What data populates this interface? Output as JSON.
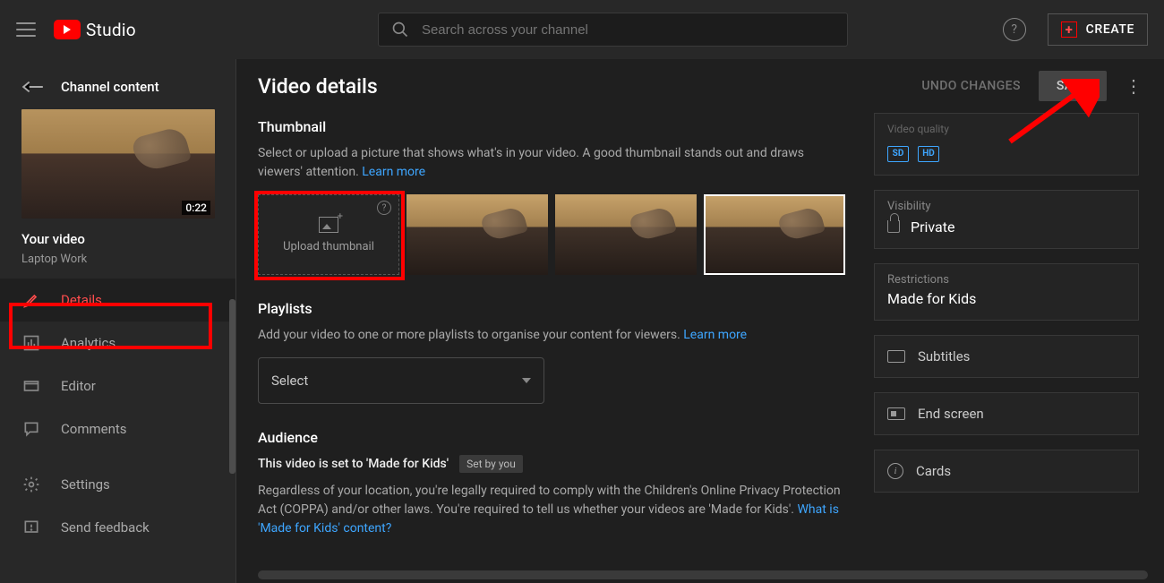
{
  "header": {
    "logo_text": "Studio",
    "search_placeholder": "Search across your channel",
    "create_label": "CREATE"
  },
  "sidebar": {
    "back_label": "Channel content",
    "video_duration": "0:22",
    "your_video_label": "Your video",
    "video_title": "Laptop Work",
    "items": [
      {
        "label": "Details"
      },
      {
        "label": "Analytics"
      },
      {
        "label": "Editor"
      },
      {
        "label": "Comments"
      },
      {
        "label": "Settings"
      },
      {
        "label": "Send feedback"
      }
    ]
  },
  "main": {
    "title": "Video details",
    "undo_label": "UNDO CHANGES",
    "save_label": "SAVE",
    "thumbnail": {
      "title": "Thumbnail",
      "desc": "Select or upload a picture that shows what's in your video. A good thumbnail stands out and draws viewers' attention. ",
      "learn_more": "Learn more",
      "upload_label": "Upload thumbnail"
    },
    "playlists": {
      "title": "Playlists",
      "desc": "Add your video to one or more playlists to organise your content for viewers. ",
      "learn_more": "Learn more",
      "select_label": "Select"
    },
    "audience": {
      "title": "Audience",
      "status_line": "This video is set to 'Made for Kids'",
      "chip": "Set by you",
      "desc": "Regardless of your location, you're legally required to comply with the Children's Online Privacy Protection Act (COPPA) and/or other laws. You're required to tell us whether your videos are 'Made for Kids'. ",
      "link": "What is 'Made for Kids' content?"
    }
  },
  "right": {
    "video_quality_label": "Video quality",
    "sd_badge": "SD",
    "hd_badge": "HD",
    "visibility_label": "Visibility",
    "visibility_value": "Private",
    "restrictions_label": "Restrictions",
    "restrictions_value": "Made for Kids",
    "subtitles_label": "Subtitles",
    "endscreen_label": "End screen",
    "cards_label": "Cards"
  }
}
